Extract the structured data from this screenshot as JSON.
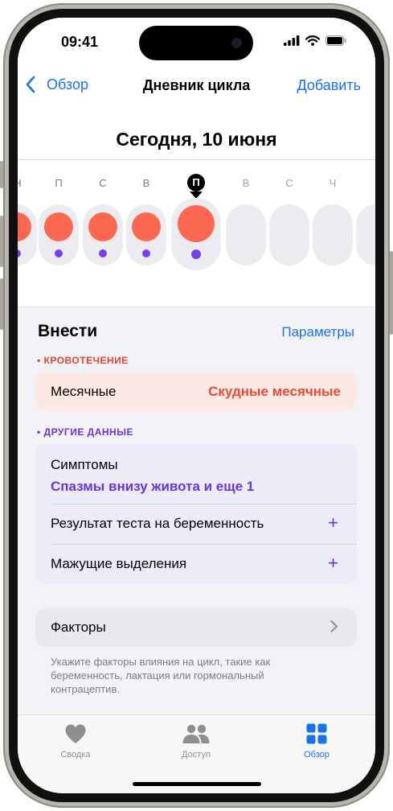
{
  "status": {
    "time": "09:41"
  },
  "nav": {
    "back_label": "Обзор",
    "title": "Дневник цикла",
    "add_label": "Добавить"
  },
  "date_title": "Сегодня, 10 июня",
  "days": [
    {
      "letter": "Н",
      "period": true,
      "symptom": true
    },
    {
      "letter": "П",
      "period": true,
      "symptom": true
    },
    {
      "letter": "С",
      "period": true,
      "symptom": true
    },
    {
      "letter": "В",
      "period": true,
      "symptom": true
    },
    {
      "letter": "П",
      "period": true,
      "symptom": true,
      "today": true
    },
    {
      "letter": "В",
      "period": false,
      "symptom": false
    },
    {
      "letter": "С",
      "period": false,
      "symptom": false
    },
    {
      "letter": "Ч",
      "period": false,
      "symptom": false
    }
  ],
  "log": {
    "title": "Внести",
    "params_label": "Параметры",
    "bleeding": {
      "header": "• КРОВОТЕЧЕНИЕ",
      "label": "Месячные",
      "value": "Скудные месячные"
    },
    "other": {
      "header": "• ДРУГИЕ ДАННЫЕ",
      "symptoms_label": "Симптомы",
      "symptoms_value": "Спазмы внизу живота и еще 1",
      "pregnancy_test_label": "Результат теста на беременность",
      "spotting_label": "Мажущие выделения",
      "add_symbol": "+"
    },
    "factors": {
      "label": "Факторы",
      "note": "Укажите факторы влияния на цикл, такие как беременность, лактация или гормональный контрацептив."
    }
  },
  "tabs": [
    {
      "label": "Сводка",
      "icon": "heart-icon",
      "active": false
    },
    {
      "label": "Доступ",
      "icon": "people-icon",
      "active": false
    },
    {
      "label": "Обзор",
      "icon": "grid-icon",
      "active": true
    }
  ],
  "colors": {
    "accent": "#1a73e8",
    "period": "#fb6750",
    "symptom": "#7a3cf0",
    "inactive_tab": "#8e8e93"
  }
}
